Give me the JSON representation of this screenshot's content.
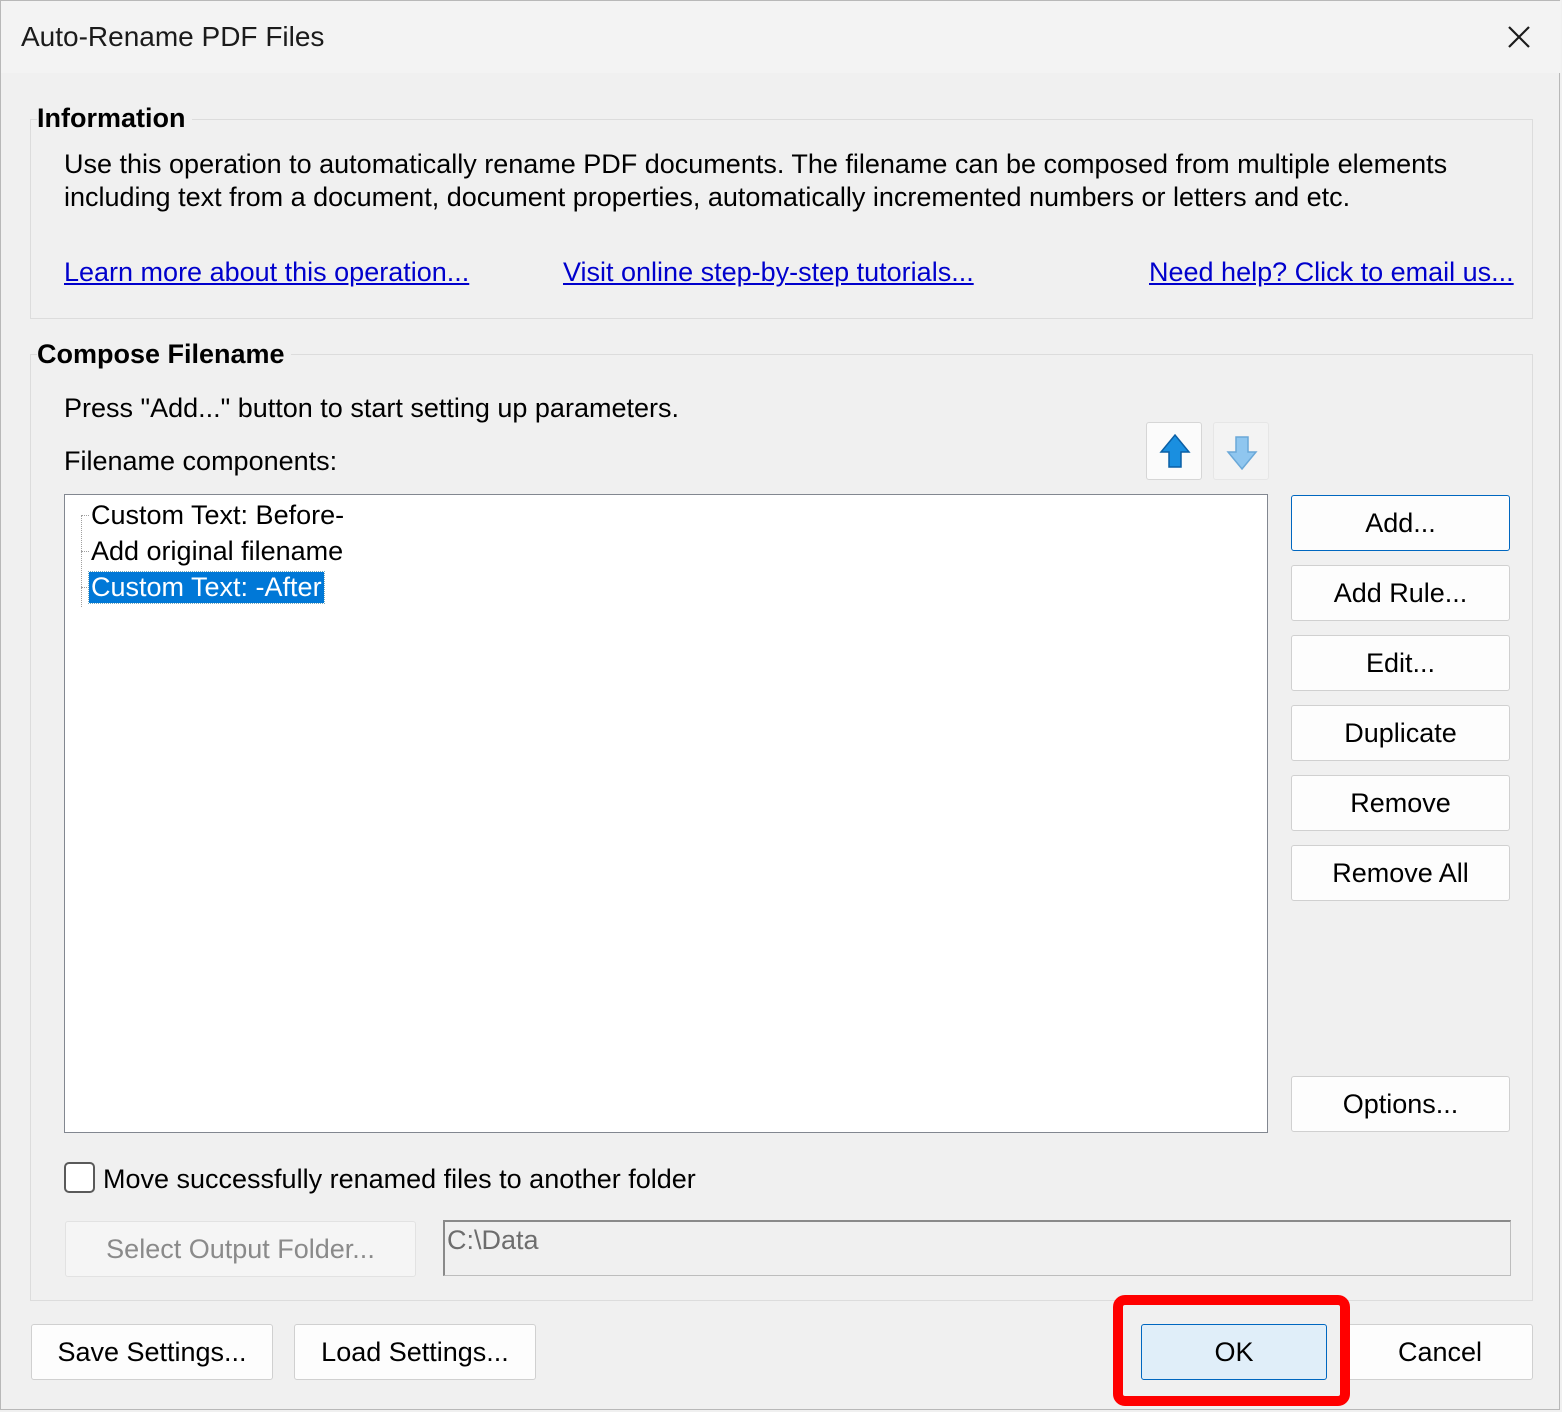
{
  "window": {
    "title": "Auto-Rename PDF Files"
  },
  "information": {
    "title": "Information",
    "line1": "Use this operation to automatically rename PDF documents. The filename can be composed from multiple elements",
    "line2": "including text from a document, document properties, automatically incremented numbers or letters and etc.",
    "links": {
      "learn_more": "Learn more about this operation...",
      "tutorials": "Visit online step-by-step tutorials...",
      "help": "Need help? Click to email us..."
    }
  },
  "compose": {
    "title": "Compose Filename",
    "instruction": "Press \"Add...\" button to start setting up parameters.",
    "components_label": "Filename components:",
    "components": [
      {
        "label": "Custom Text: Before-",
        "selected": false
      },
      {
        "label": "Add original filename",
        "selected": false
      },
      {
        "label": "Custom Text: -After",
        "selected": true
      }
    ],
    "buttons": {
      "add": "Add...",
      "add_rule": "Add Rule...",
      "edit": "Edit...",
      "duplicate": "Duplicate",
      "remove": "Remove",
      "remove_all": "Remove All",
      "options": "Options..."
    },
    "move_checkbox": {
      "label": "Move successfully renamed files to another folder",
      "checked": false
    },
    "select_output_folder": "Select Output Folder...",
    "output_path": "C:\\Data"
  },
  "footer": {
    "save_settings": "Save Settings...",
    "load_settings": "Load Settings...",
    "ok": "OK",
    "cancel": "Cancel"
  },
  "colors": {
    "selection": "#0078d7",
    "link": "#0000cc",
    "highlight": "#ff0000",
    "arrow": "#1a8fe0"
  }
}
